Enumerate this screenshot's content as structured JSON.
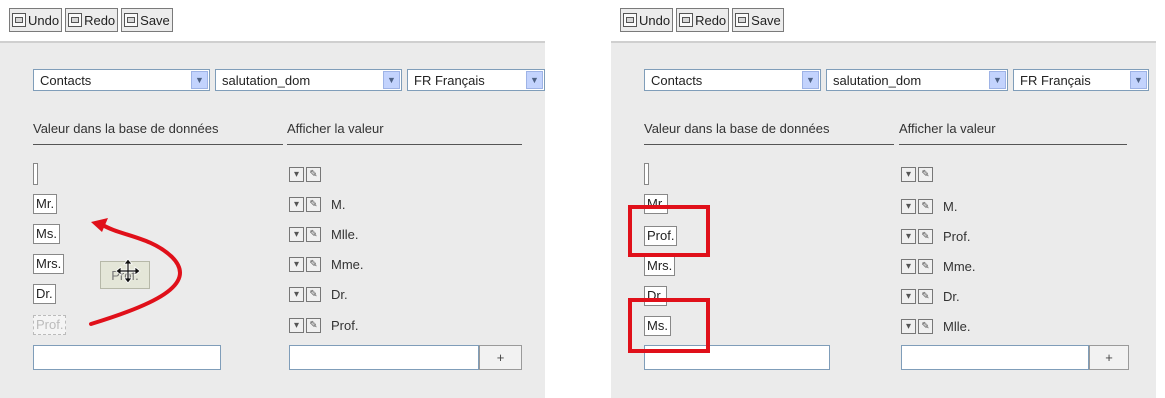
{
  "colors": {
    "highlight": "#e0101a",
    "arrow": "#e0101a",
    "panel_bg": "#ebebeb"
  },
  "panels": [
    {
      "toolbar": {
        "undo": "Undo",
        "redo": "Redo",
        "save": "Save"
      },
      "selects": {
        "module": "Contacts",
        "field": "salutation_dom",
        "language": "FR Français"
      },
      "headers": {
        "db_value": "Valeur dans la base de données",
        "display_value": "Afficher la valeur"
      },
      "db_values": [
        "",
        "Mr.",
        "Ms.",
        "Mrs.",
        "Dr.",
        "Prof."
      ],
      "display_values": [
        "",
        "M.",
        "Mlle.",
        "Mme.",
        "Dr.",
        "Prof."
      ],
      "dragging_item": "Prof.",
      "add_button": "+"
    },
    {
      "toolbar": {
        "undo": "Undo",
        "redo": "Redo",
        "save": "Save"
      },
      "selects": {
        "module": "Contacts",
        "field": "salutation_dom",
        "language": "FR Français"
      },
      "headers": {
        "db_value": "Valeur dans la base de données",
        "display_value": "Afficher la valeur"
      },
      "db_values": [
        "",
        "Mr.",
        "Prof.",
        "Mrs.",
        "Dr.",
        "Ms."
      ],
      "display_values": [
        "",
        "M.",
        "Prof.",
        "Mme.",
        "Dr.",
        "Mlle."
      ],
      "add_button": "+"
    }
  ]
}
